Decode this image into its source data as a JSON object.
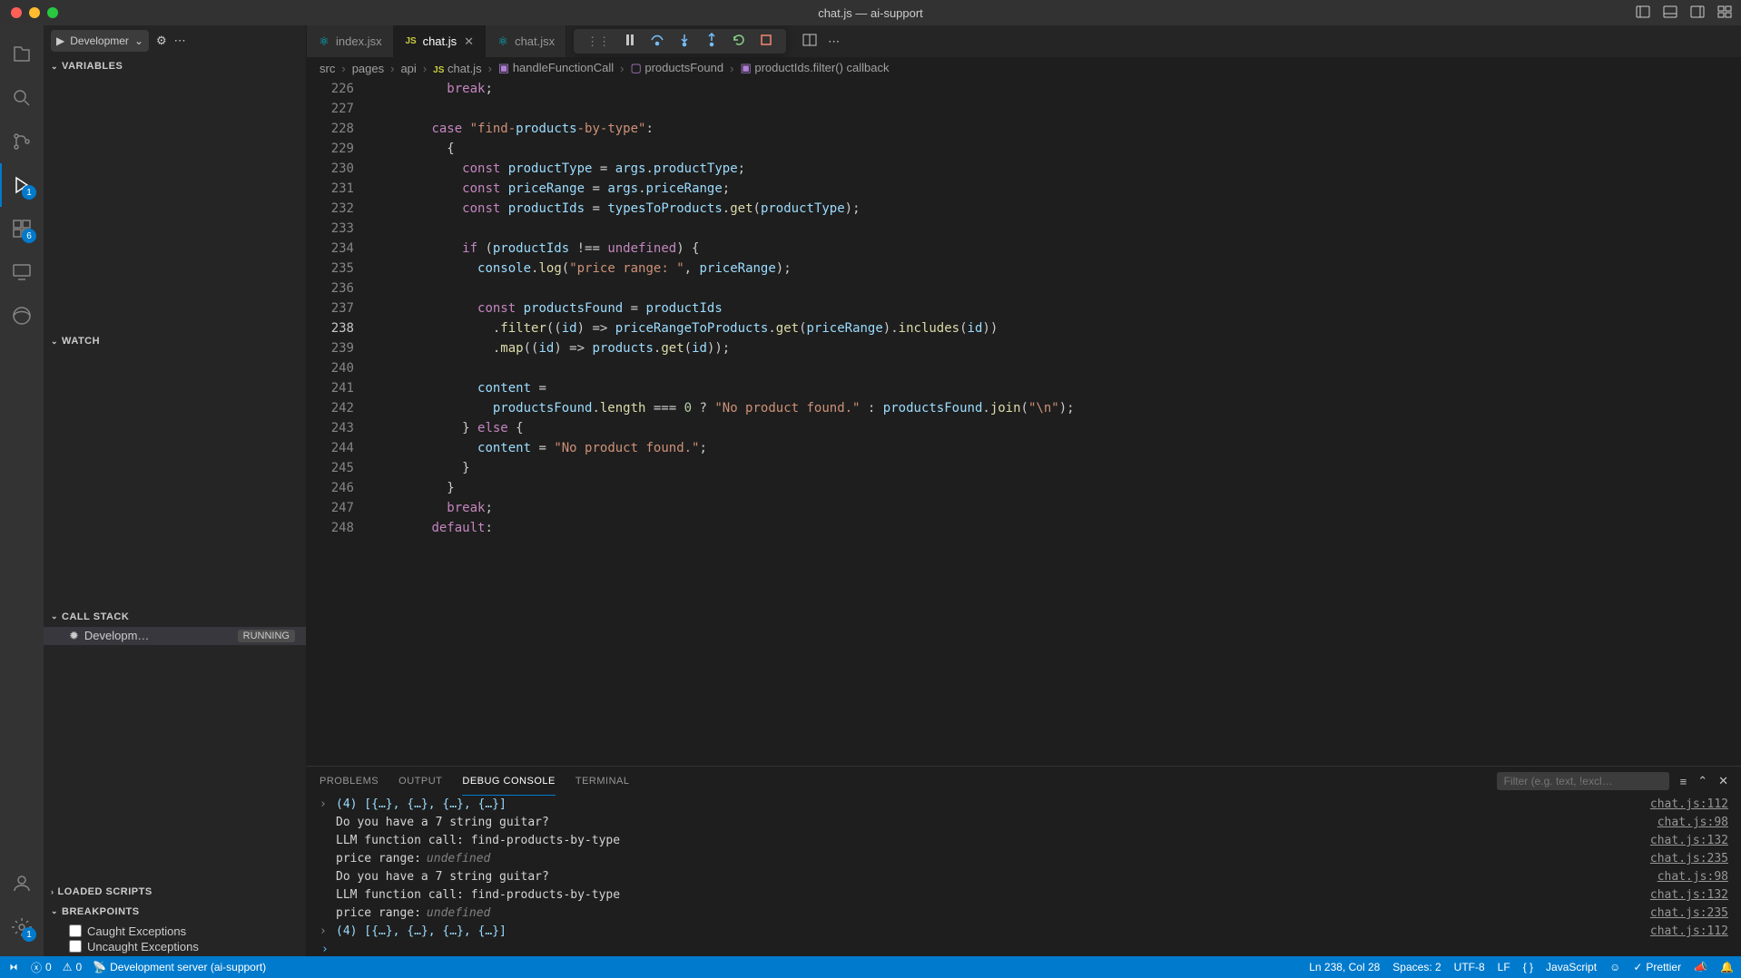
{
  "window": {
    "title": "chat.js — ai-support"
  },
  "debugToolbar": {
    "config": "Developmer"
  },
  "sidebar": {
    "variables": {
      "label": "VARIABLES"
    },
    "watch": {
      "label": "WATCH"
    },
    "callstack": {
      "label": "CALL STACK",
      "item": {
        "name": "Developm…",
        "status": "RUNNING"
      }
    },
    "loadedScripts": {
      "label": "LOADED SCRIPTS"
    },
    "breakpoints": {
      "label": "BREAKPOINTS",
      "caught": "Caught Exceptions",
      "uncaught": "Uncaught Exceptions"
    }
  },
  "tabs": [
    {
      "name": "index.jsx",
      "kind": "react",
      "active": false
    },
    {
      "name": "chat.js",
      "kind": "js",
      "active": true
    },
    {
      "name": "chat.jsx",
      "kind": "react",
      "active": false
    }
  ],
  "breadcrumbs": [
    {
      "label": "src",
      "kind": "folder"
    },
    {
      "label": "pages",
      "kind": "folder"
    },
    {
      "label": "api",
      "kind": "folder"
    },
    {
      "label": "chat.js",
      "kind": "jsfile"
    },
    {
      "label": "handleFunctionCall",
      "kind": "fn"
    },
    {
      "label": "productsFound",
      "kind": "var"
    },
    {
      "label": "productIds.filter() callback",
      "kind": "fn"
    }
  ],
  "editor": {
    "startLine": 226,
    "currentLine": 238,
    "lines": [
      "          break;",
      "",
      "        case \"find-products-by-type\":",
      "          {",
      "            const productType = args.productType;",
      "            const priceRange = args.priceRange;",
      "            const productIds = typesToProducts.get(productType);",
      "",
      "            if (productIds !== undefined) {",
      "              console.log(\"price range: \", priceRange);",
      "",
      "              const productsFound = productIds",
      "                .filter((id) => priceRangeToProducts.get(priceRange).includes(id))",
      "                .map((id) => products.get(id));",
      "",
      "              content =",
      "                productsFound.length === 0 ? \"No product found.\" : productsFound.join(\"\\n\");",
      "            } else {",
      "              content = \"No product found.\";",
      "            }",
      "          }",
      "          break;",
      "        default:"
    ]
  },
  "panel": {
    "tabs": {
      "problems": "PROBLEMS",
      "output": "OUTPUT",
      "debug": "DEBUG CONSOLE",
      "terminal": "TERMINAL"
    },
    "filterPlaceholder": "Filter (e.g. text, !excl…",
    "lines": [
      {
        "expand": "›",
        "text": "(4) [{…}, {…}, {…}, {…}]",
        "loc": "chat.js:112"
      },
      {
        "text": "Do you have a 7 string guitar?",
        "loc": "chat.js:98",
        "white": true
      },
      {
        "text": "LLM function call:  find-products-by-type",
        "loc": "chat.js:132",
        "white": true
      },
      {
        "text": "price range:  undefined",
        "loc": "chat.js:235",
        "undef": true
      },
      {
        "text": "Do you have a 7 string guitar?",
        "loc": "chat.js:98",
        "white": true
      },
      {
        "text": "LLM function call:  find-products-by-type",
        "loc": "chat.js:132",
        "white": true
      },
      {
        "text": "price range:  undefined",
        "loc": "chat.js:235",
        "undef": true
      },
      {
        "expand": "›",
        "text": "(4) [{…}, {…}, {…}, {…}]",
        "loc": "chat.js:112"
      }
    ]
  },
  "statusbar": {
    "errors": "0",
    "warnings": "0",
    "server": "Development server (ai-support)",
    "position": "Ln 238, Col 28",
    "spaces": "Spaces: 2",
    "encoding": "UTF-8",
    "eol": "LF",
    "lang": "JavaScript",
    "prettier": "Prettier"
  },
  "activityBadges": {
    "debug": "1",
    "ext": "6",
    "settings": "1"
  }
}
